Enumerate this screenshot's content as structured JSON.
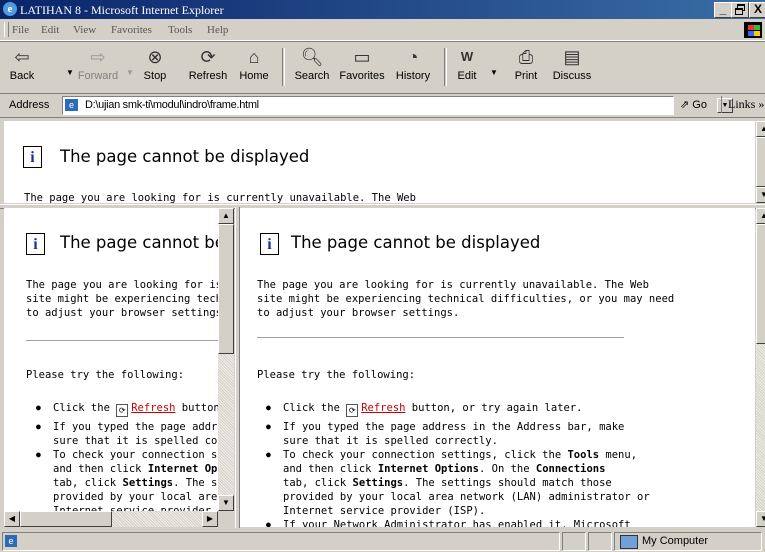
{
  "window": {
    "title": "LATIHAN 8 - Microsoft Internet Explorer",
    "min": "_",
    "max": "🗗",
    "close": "X"
  },
  "menu": [
    "File",
    "Edit",
    "View",
    "Favorites",
    "Tools",
    "Help"
  ],
  "toolbar": {
    "back": "Back",
    "forward": "Forward",
    "stop": "Stop",
    "refresh": "Refresh",
    "home": "Home",
    "search": "Search",
    "favorites": "Favorites",
    "history": "History",
    "edit": "Edit",
    "print": "Print",
    "discuss": "Discuss"
  },
  "address": {
    "label": "Address",
    "url": "D:\\ujian smk-ti\\modul\\indro\\frame.html",
    "go": "Go",
    "links": "Links »"
  },
  "error": {
    "heading": "The page cannot be displayed",
    "para": "The page you are looking for is currently unavailable. The Web\nsite might be experiencing technical difficulties, or you may need\nto adjust your browser settings.",
    "try": "Please try the following:",
    "b1_pre": "Click the ",
    "b1_link": "Refresh",
    "b1_post": " button, or try again later.",
    "b2": "If you typed the page address in the Address bar, make\nsure that it is spelled correctly.",
    "b3_a": "To check your connection settings, click the ",
    "b3_tools": "Tools",
    "b3_b": " menu,\nand then click ",
    "b3_io": "Internet Options",
    "b3_c": ". On the ",
    "b3_conn": "Connections",
    "b3_d": "\ntab, click ",
    "b3_set": "Settings",
    "b3_e": ". The settings should match those\nprovided by your local area network (LAN) administrator or\nInternet service provider (ISP).",
    "b4": "If your Network Administrator has enabled it, Microsoft",
    "top_partial": "The page you are looking for is currently unavailable. The Web"
  },
  "status": {
    "zone": "My Computer"
  }
}
